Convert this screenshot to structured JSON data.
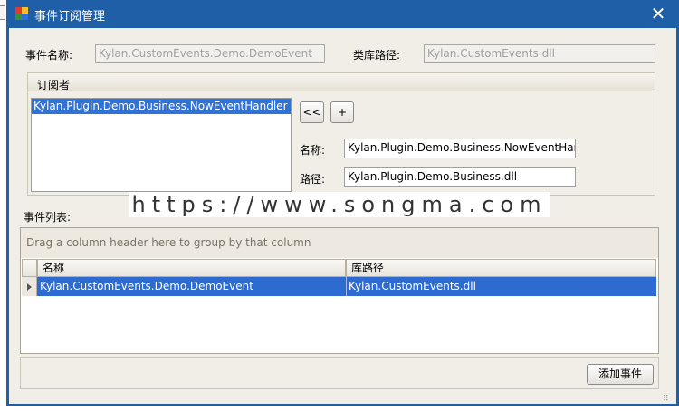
{
  "window": {
    "title": "事件订阅管理",
    "close_glyph": "✕"
  },
  "form": {
    "event_name_label": "事件名称:",
    "event_name_value": "Kylan.CustomEvents.Demo.DemoEvent",
    "lib_path_label": "类库路径:",
    "lib_path_value": "Kylan.CustomEvents.dll"
  },
  "subscribers": {
    "group_title": "订阅者",
    "items": [
      "Kylan.Plugin.Demo.Business.NowEventHandler"
    ],
    "remove_button": "<<",
    "add_button": "+",
    "name_label": "名称:",
    "name_value": "Kylan.Plugin.Demo.Business.NowEventHandler",
    "path_label": "路径:",
    "path_value": "Kylan.Plugin.Demo.Business.dll"
  },
  "watermark": "https://www.songma.com",
  "events": {
    "label": "事件列表:",
    "group_panel_text": "Drag a column header here to group by that column",
    "columns": [
      "名称",
      "库路径"
    ],
    "rows": [
      {
        "name": "Kylan.CustomEvents.Demo.DemoEvent",
        "lib": "Kylan.CustomEvents.dll"
      }
    ]
  },
  "footer": {
    "add_event_button": "添加事件"
  },
  "colors": {
    "titlebar": "#1e5fa8",
    "selection": "#2d6bd0",
    "client_bg": "#f1eee8"
  }
}
